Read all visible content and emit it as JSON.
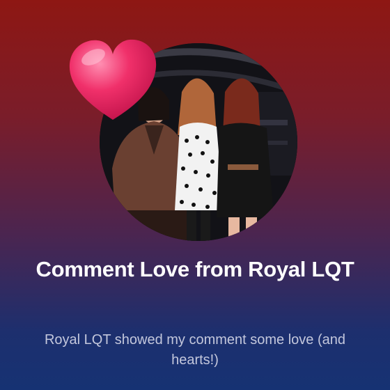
{
  "card": {
    "title": "Comment Love from Royal LQT",
    "subtitle": "Royal LQT showed my comment some love (and hearts!)"
  },
  "photo": {
    "icon": "group-photo",
    "description_visible": false
  },
  "badge": {
    "icon": "heart-icon",
    "color": "#f0306a"
  },
  "colors": {
    "gradient_top": "#8e1713",
    "gradient_bottom": "#163273",
    "title": "#ffffff",
    "subtitle": "#c3c7dc"
  }
}
